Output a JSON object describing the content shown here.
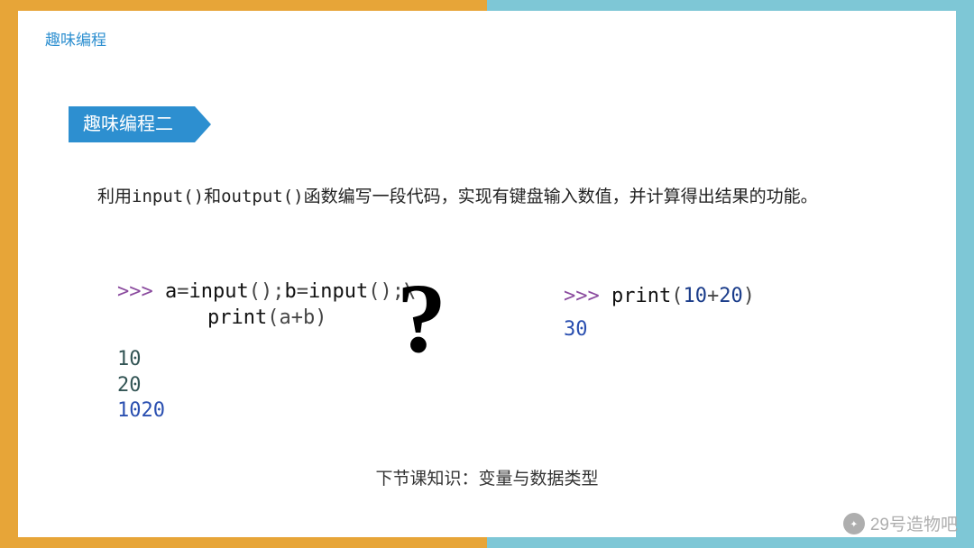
{
  "header": {
    "label": "趣味编程"
  },
  "section": {
    "title": "趣味编程二"
  },
  "description": {
    "text": "利用input()和output()函数编写一段代码，实现有键盘输入数值，并计算得出结果的功能。",
    "prefix": "利用",
    "fn1": "input()",
    "mid1": "和",
    "fn2": "output()",
    "suffix": "函数编写一段代码，实现有键盘输入数值，并计算得出结果的功能。"
  },
  "code_left": {
    "prompt": ">>> ",
    "line1_a": "a",
    "line1_eq": "=",
    "line1_input1": "input",
    "line1_paren": "()",
    "line1_sep": ";",
    "line1_b": "b",
    "line1_input2": "input",
    "line1_cont": ";\\",
    "line2_print": "print",
    "line2_args": "(a+b)",
    "out1": "10",
    "out2": "20",
    "out3": "1020"
  },
  "qmark": "?",
  "code_right": {
    "prompt": ">>> ",
    "print": "print",
    "args_open": "(",
    "n1": "10",
    "plus": "+",
    "n2": "20",
    "args_close": ")",
    "out": "30"
  },
  "footer": {
    "note": "下节课知识：变量与数据类型"
  },
  "watermark": {
    "label": "29号造物吧"
  }
}
